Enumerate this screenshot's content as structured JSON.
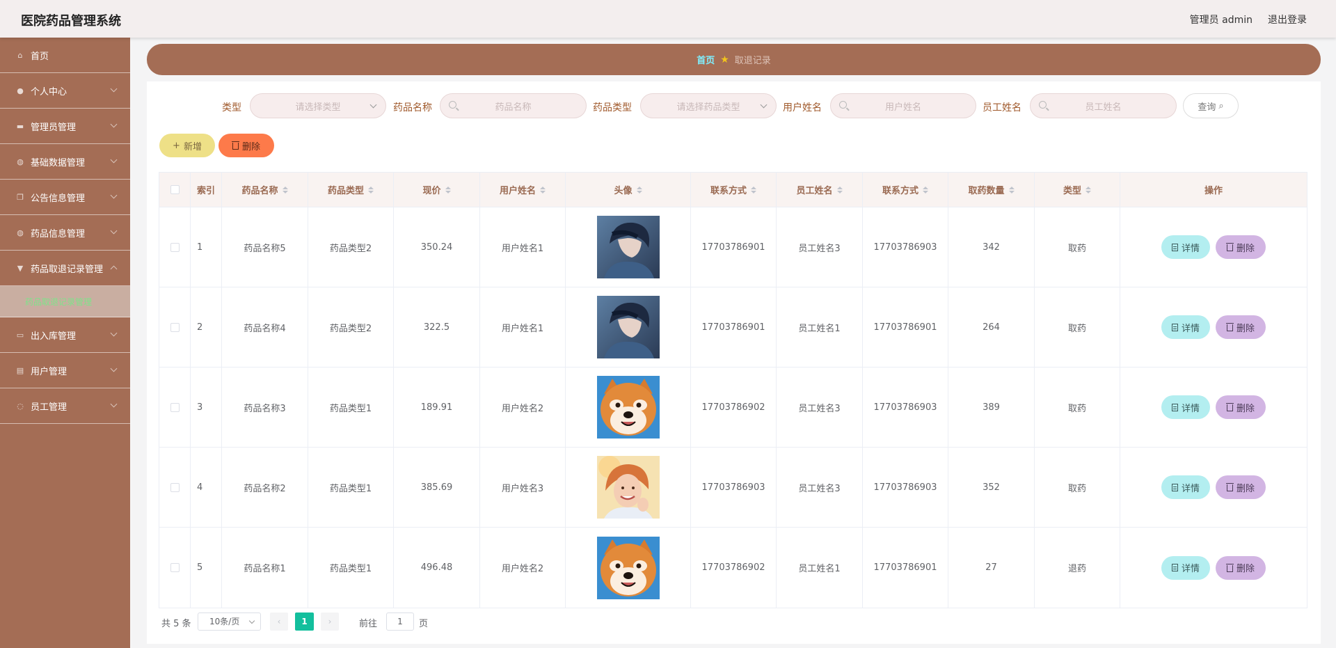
{
  "header": {
    "title": "医院药品管理系统",
    "user": "管理员 admin",
    "logout": "退出登录"
  },
  "sidebar": {
    "items": [
      {
        "label": "首页",
        "icon": "home-icon"
      },
      {
        "label": "个人中心",
        "icon": "user-icon"
      },
      {
        "label": "管理员管理",
        "icon": "id-card-icon"
      },
      {
        "label": "基础数据管理",
        "icon": "globe-icon"
      },
      {
        "label": "公告信息管理",
        "icon": "copy-icon"
      },
      {
        "label": "药品信息管理",
        "icon": "globe-icon"
      },
      {
        "label": "药品取退记录管理",
        "icon": "trophy-icon"
      },
      {
        "label": "出入库管理",
        "icon": "briefcase-icon"
      },
      {
        "label": "用户管理",
        "icon": "clipboard-icon"
      },
      {
        "label": "员工管理",
        "icon": "power-icon"
      }
    ],
    "active_sub": "药品取退记录管理"
  },
  "breadcrumb": {
    "home": "首页",
    "current": "取退记录"
  },
  "search": {
    "type_label": "类型",
    "type_placeholder": "请选择类型",
    "drug_name_label": "药品名称",
    "drug_name_placeholder": "药品名称",
    "drug_type_label": "药品类型",
    "drug_type_placeholder": "请选择药品类型",
    "user_name_label": "用户姓名",
    "user_name_placeholder": "用户姓名",
    "staff_name_label": "员工姓名",
    "staff_name_placeholder": "员工姓名",
    "query_button": "查询"
  },
  "actions": {
    "add": "新增",
    "delete": "删除"
  },
  "table": {
    "headers": [
      "索引",
      "药品名称",
      "药品类型",
      "现价",
      "用户姓名",
      "头像",
      "联系方式",
      "员工姓名",
      "联系方式",
      "取药数量",
      "类型",
      "操作"
    ],
    "rows": [
      {
        "index": "1",
        "drug_name": "药品名称5",
        "drug_type": "药品类型2",
        "price": "350.24",
        "user_name": "用户姓名1",
        "avatar": "anime-boy",
        "user_phone": "17703786901",
        "staff_name": "员工姓名3",
        "staff_phone": "17703786903",
        "quantity": "342",
        "type": "取药"
      },
      {
        "index": "2",
        "drug_name": "药品名称4",
        "drug_type": "药品类型2",
        "price": "322.5",
        "user_name": "用户姓名1",
        "avatar": "anime-boy",
        "user_phone": "17703786901",
        "staff_name": "员工姓名1",
        "staff_phone": "17703786901",
        "quantity": "264",
        "type": "取药"
      },
      {
        "index": "3",
        "drug_name": "药品名称3",
        "drug_type": "药品类型1",
        "price": "189.91",
        "user_name": "用户姓名2",
        "avatar": "shiba-dog",
        "user_phone": "17703786902",
        "staff_name": "员工姓名3",
        "staff_phone": "17703786903",
        "quantity": "389",
        "type": "取药"
      },
      {
        "index": "4",
        "drug_name": "药品名称2",
        "drug_type": "药品类型1",
        "price": "385.69",
        "user_name": "用户姓名3",
        "avatar": "smiling-woman",
        "user_phone": "17703786903",
        "staff_name": "员工姓名3",
        "staff_phone": "17703786903",
        "quantity": "352",
        "type": "取药"
      },
      {
        "index": "5",
        "drug_name": "药品名称1",
        "drug_type": "药品类型1",
        "price": "496.48",
        "user_name": "用户姓名2",
        "avatar": "shiba-dog",
        "user_phone": "17703786902",
        "staff_name": "员工姓名1",
        "staff_phone": "17703786901",
        "quantity": "27",
        "type": "退药"
      }
    ],
    "detail_label": "详情",
    "delete_label": "删除"
  },
  "pagination": {
    "total": "共 5 条",
    "page_size": "10条/页",
    "current_page": "1",
    "goto_label": "前往",
    "goto_value": "1",
    "page_suffix": "页"
  },
  "colors": {
    "sidebar": "#a46d55",
    "accent_green": "#13bf9d",
    "add_button": "#eee087",
    "delete_button": "#fd7a4a",
    "detail_button": "#b3eef0",
    "row_delete_button": "#d2b5e3"
  }
}
